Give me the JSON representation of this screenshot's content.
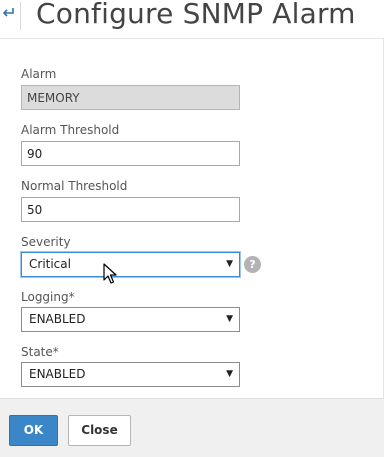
{
  "header": {
    "title": "Configure SNMP Alarm"
  },
  "form": {
    "alarm": {
      "label": "Alarm",
      "value": "MEMORY"
    },
    "alarm_threshold": {
      "label": "Alarm Threshold",
      "value": "90"
    },
    "normal_threshold": {
      "label": "Normal Threshold",
      "value": "50"
    },
    "severity": {
      "label": "Severity",
      "value": "Critical",
      "help_symbol": "?"
    },
    "logging": {
      "label": "Logging*",
      "value": "ENABLED"
    },
    "state": {
      "label": "State*",
      "value": "ENABLED"
    },
    "caret_symbol": "▼"
  },
  "footer": {
    "ok_label": "OK",
    "close_label": "Close"
  },
  "colors": {
    "primary_button": "#3b86c7",
    "focus_border": "#3b8ed4",
    "readonly_field": "#dcdcdc"
  },
  "icons": {
    "back": "back-arrow-icon",
    "help": "question-mark-icon",
    "cursor": "mouse-pointer-icon",
    "dropdown": "chevron-down-icon"
  }
}
